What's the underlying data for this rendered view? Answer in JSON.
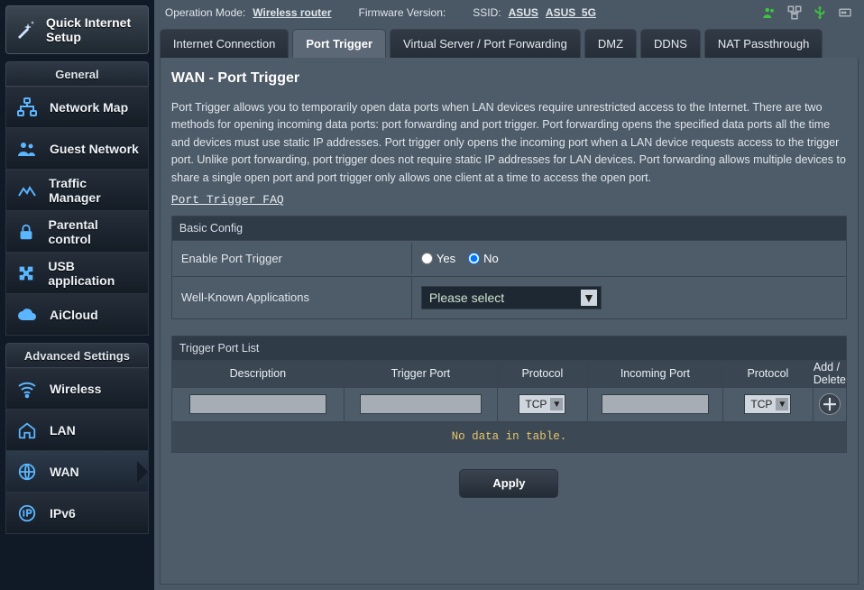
{
  "quick_setup": {
    "label": "Quick Internet\nSetup"
  },
  "sections": {
    "general": "General",
    "advanced": "Advanced Settings"
  },
  "menu_general": [
    {
      "id": "network-map",
      "label": "Network Map"
    },
    {
      "id": "guest-network",
      "label": "Guest Network"
    },
    {
      "id": "traffic-manager",
      "label": "Traffic Manager"
    },
    {
      "id": "parental-control",
      "label": "Parental control"
    },
    {
      "id": "usb-application",
      "label": "USB application"
    },
    {
      "id": "aicloud",
      "label": "AiCloud"
    }
  ],
  "menu_advanced": [
    {
      "id": "wireless",
      "label": "Wireless"
    },
    {
      "id": "lan",
      "label": "LAN"
    },
    {
      "id": "wan",
      "label": "WAN"
    },
    {
      "id": "ipv6",
      "label": "IPv6"
    }
  ],
  "active_menu": "wan",
  "topbar": {
    "op_mode_label": "Operation Mode:",
    "op_mode_value": "Wireless router",
    "fw_label": "Firmware Version:",
    "ssid_label": "SSID:",
    "ssid1": "ASUS",
    "ssid2": "ASUS_5G"
  },
  "tabs": [
    "Internet Connection",
    "Port Trigger",
    "Virtual Server / Port Forwarding",
    "DMZ",
    "DDNS",
    "NAT Passthrough"
  ],
  "active_tab": 1,
  "page": {
    "title": "WAN - Port Trigger",
    "desc": "Port Trigger allows you to temporarily open data ports when LAN devices require unrestricted access to the Internet. There are two methods for opening incoming data ports: port forwarding and port trigger. Port forwarding opens the specified data ports all the time and devices must use static IP addresses. Port trigger only opens the incoming port when a LAN device requests access to the trigger port. Unlike port forwarding, port trigger does not require static IP addresses for LAN devices. Port forwarding allows multiple devices to share a single open port and port trigger only allows one client at a time to access the open port.",
    "faq": "Port Trigger FAQ",
    "basic_config": {
      "heading": "Basic Config",
      "enable_label": "Enable Port Trigger",
      "yes": "Yes",
      "no": "No",
      "selected": "no",
      "wka_label": "Well-Known Applications",
      "wka_value": "Please select"
    },
    "trigger_list": {
      "heading": "Trigger Port List",
      "cols": [
        "Description",
        "Trigger Port",
        "Protocol",
        "Incoming Port",
        "Protocol",
        "Add / Delete"
      ],
      "proto1": "TCP",
      "proto2": "TCP",
      "empty": "No data in table."
    },
    "apply": "Apply"
  }
}
